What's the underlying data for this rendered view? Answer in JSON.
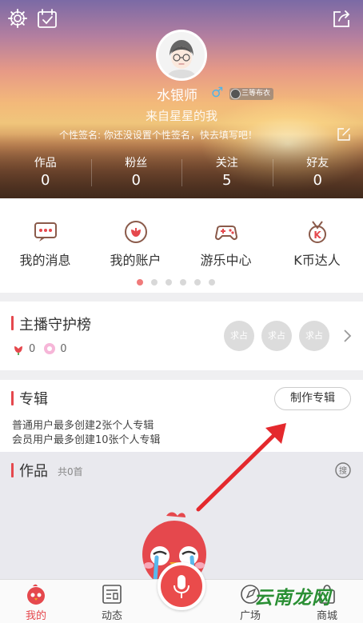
{
  "header": {
    "username": "水银师",
    "gender_symbol": "♂",
    "level_badge": "三等布衣",
    "origin": "来自星星的我",
    "signature": "个性签名: 你还没设置个性签名，快去填写吧！",
    "stats": [
      {
        "label": "作品",
        "value": "0"
      },
      {
        "label": "粉丝",
        "value": "0"
      },
      {
        "label": "关注",
        "value": "5"
      },
      {
        "label": "好友",
        "value": "0"
      }
    ]
  },
  "quick_menu": {
    "items": [
      {
        "label": "我的消息",
        "icon": "message-icon"
      },
      {
        "label": "我的账户",
        "icon": "account-flower-icon"
      },
      {
        "label": "游乐中心",
        "icon": "gamepad-icon"
      },
      {
        "label": "K币达人",
        "icon": "k-medal-icon"
      }
    ],
    "page_count": 6,
    "active_page": 0
  },
  "guard": {
    "title": "主播守护榜",
    "flower_count": "0",
    "gift_count": "0",
    "seat_label": "求占"
  },
  "album": {
    "title": "专辑",
    "create_button": "制作专辑",
    "note_normal": "普通用户最多创建2张个人专辑",
    "note_member": "会员用户最多创建10张个人专辑"
  },
  "works": {
    "title": "作品",
    "count_text": "共0首"
  },
  "bottom_nav": {
    "items": [
      {
        "label": "我的",
        "active": true
      },
      {
        "label": "动态",
        "active": false
      },
      {
        "label": "广场",
        "active": false
      },
      {
        "label": "商城",
        "active": false
      }
    ]
  },
  "watermark": "云南龙网",
  "colors": {
    "accent": "#e5484d",
    "gender": "#4fb4e8",
    "watermark": "#2a8f34"
  }
}
